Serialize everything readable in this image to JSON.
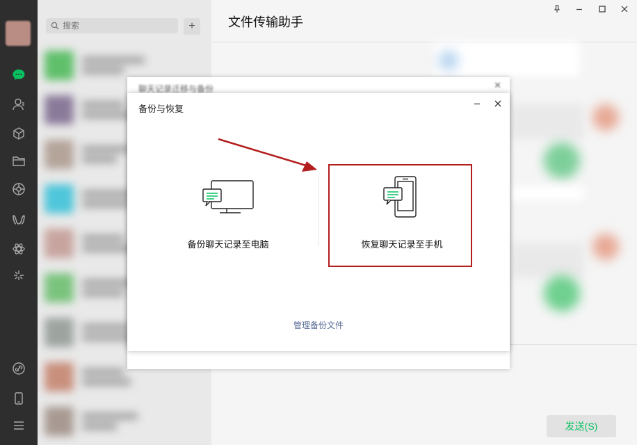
{
  "search": {
    "placeholder": "搜索"
  },
  "contacts": {
    "add_label": "+"
  },
  "chat": {
    "title": "文件传输助手",
    "send_label": "发送(S)"
  },
  "window_controls": {
    "pin": "pin-icon",
    "minimize": "minimize-icon",
    "maximize": "maximize-icon",
    "close": "close-icon"
  },
  "back_dialog": {
    "title": "聊天记录迁移与备份"
  },
  "dialog": {
    "title": "备份与恢复",
    "options": [
      {
        "label": "备份聊天记录至电脑",
        "icon": "monitor-chat-icon"
      },
      {
        "label": "恢复聊天记录至手机",
        "icon": "phone-chat-icon"
      }
    ],
    "manage_label": "管理备份文件"
  },
  "colors": {
    "brand_green": "#07c160",
    "link_blue": "#576b95",
    "highlight_red": "#b31d1d",
    "rail_bg": "#2e2e2e"
  }
}
